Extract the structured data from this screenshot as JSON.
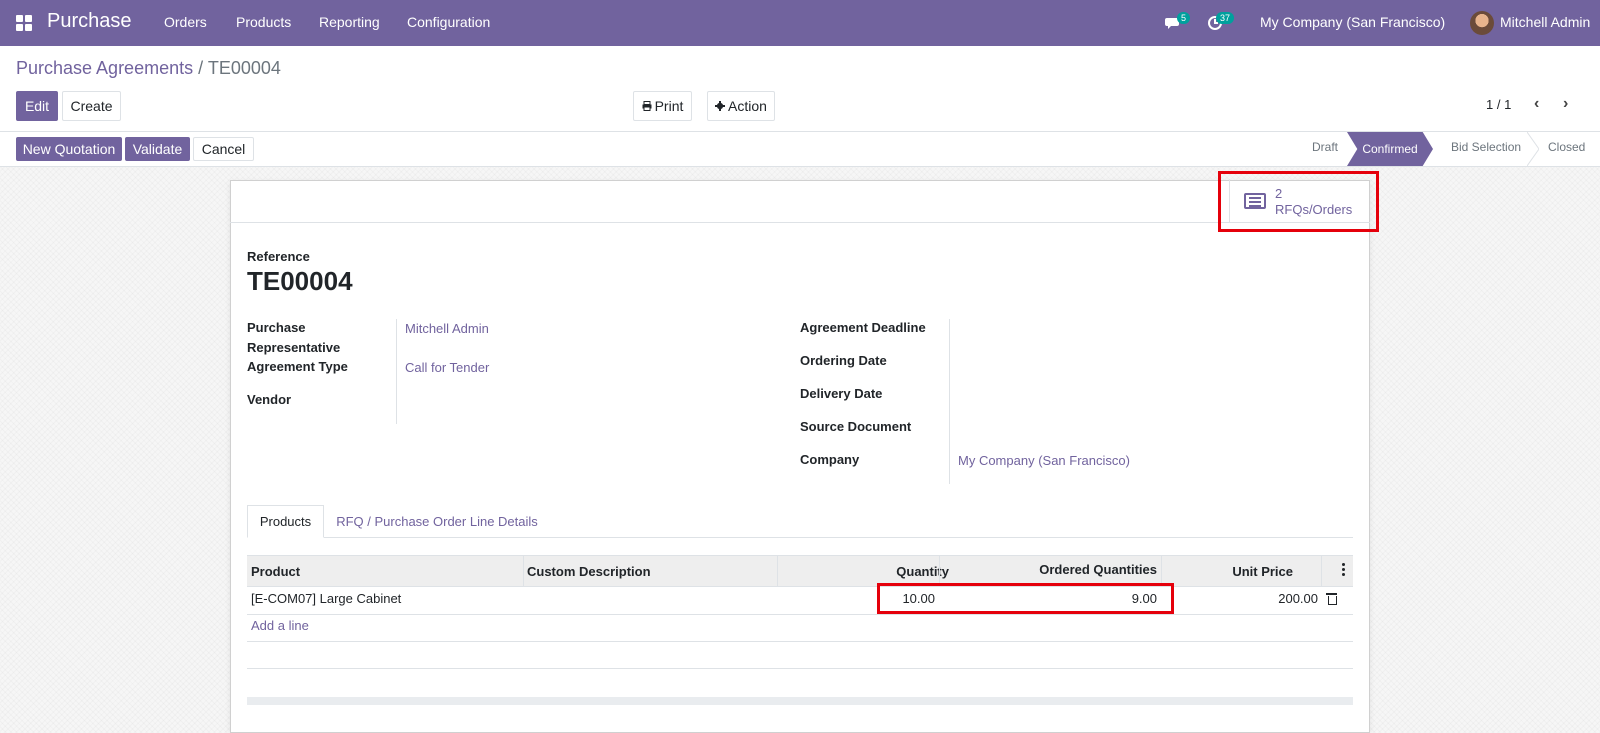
{
  "navbar": {
    "app_name": "Purchase",
    "menus": [
      "Orders",
      "Products",
      "Reporting",
      "Configuration"
    ],
    "messages_count": "5",
    "activities_count": "37",
    "company": "My Company (San Francisco)",
    "user": "Mitchell Admin"
  },
  "breadcrumb": {
    "parent": "Purchase Agreements",
    "separator": "/",
    "current": "TE00004"
  },
  "toolbar": {
    "edit": "Edit",
    "create": "Create",
    "print": "Print",
    "action": "Action",
    "pager": "1 / 1"
  },
  "header_buttons": {
    "new_quotation": "New Quotation",
    "validate": "Validate",
    "cancel": "Cancel"
  },
  "statusbar": {
    "stages": [
      "Draft",
      "Confirmed",
      "Bid Selection",
      "Closed"
    ],
    "active": "Confirmed"
  },
  "smart_button": {
    "count": "2",
    "label": "RFQs/Orders"
  },
  "form": {
    "reference_label": "Reference",
    "reference": "TE00004",
    "left": {
      "purchase_rep_label_1": "Purchase",
      "purchase_rep_label_2": "Representative",
      "purchase_rep": "Mitchell Admin",
      "agreement_type_label": "Agreement Type",
      "agreement_type": "Call for Tender",
      "vendor_label": "Vendor"
    },
    "right": {
      "deadline_label": "Agreement Deadline",
      "ordering_date_label": "Ordering Date",
      "delivery_date_label": "Delivery Date",
      "source_document_label": "Source Document",
      "company_label": "Company",
      "company": "My Company (San Francisco)"
    }
  },
  "tabs": [
    "Products",
    "RFQ / Purchase Order Line Details"
  ],
  "table": {
    "columns": [
      "Product",
      "Custom Description",
      "Quantity",
      "Ordered Quantities",
      "Unit Price"
    ],
    "rows": [
      {
        "product": "[E-COM07] Large Cabinet",
        "description": "",
        "quantity": "10.00",
        "ordered": "9.00",
        "unit_price": "200.00"
      }
    ],
    "add_line": "Add a line"
  },
  "colors": {
    "brand": "#71639e",
    "highlight": "#e5000b"
  }
}
